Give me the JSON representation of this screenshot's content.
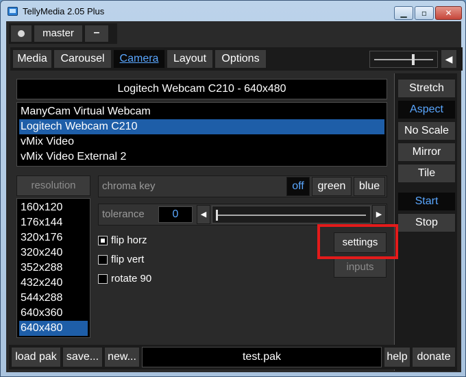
{
  "window": {
    "title": "TellyMedia 2.05 Plus"
  },
  "header": {
    "profile": "master",
    "minus_label": "–"
  },
  "tabs": [
    "Media",
    "Carousel",
    "Camera",
    "Layout",
    "Options"
  ],
  "camera": {
    "current": "Logitech Webcam C210 - 640x480",
    "devices": [
      "ManyCam Virtual Webcam",
      "Logitech Webcam C210",
      "vMix Video",
      "vMix Video External 2"
    ],
    "selected_device_index": 1
  },
  "resolution": {
    "header": "resolution",
    "options": [
      "160x120",
      "176x144",
      "320x176",
      "320x240",
      "352x288",
      "432x240",
      "544x288",
      "640x360",
      "640x480"
    ],
    "selected_index": 8
  },
  "chroma": {
    "label": "chroma key",
    "options": [
      "off",
      "green",
      "blue"
    ],
    "selected": "off"
  },
  "tolerance": {
    "label": "tolerance",
    "value": "0"
  },
  "checkboxes": [
    {
      "label": "flip horz",
      "checked": true
    },
    {
      "label": "flip vert",
      "checked": false
    },
    {
      "label": "rotate 90",
      "checked": false
    }
  ],
  "buttons": {
    "settings": "settings",
    "inputs": "inputs"
  },
  "scale_modes": [
    "Stretch",
    "Aspect",
    "No Scale",
    "Mirror",
    "Tile"
  ],
  "selected_scale_mode": "Aspect",
  "transport": {
    "start": "Start",
    "stop": "Stop"
  },
  "footer": {
    "load": "load pak",
    "save": "save...",
    "new": "new...",
    "file": "test.pak",
    "help": "help",
    "donate": "donate"
  },
  "colors": {
    "accent": "#5aa7ff",
    "selection": "#1e5ea8",
    "highlight": "#e31b1b"
  }
}
